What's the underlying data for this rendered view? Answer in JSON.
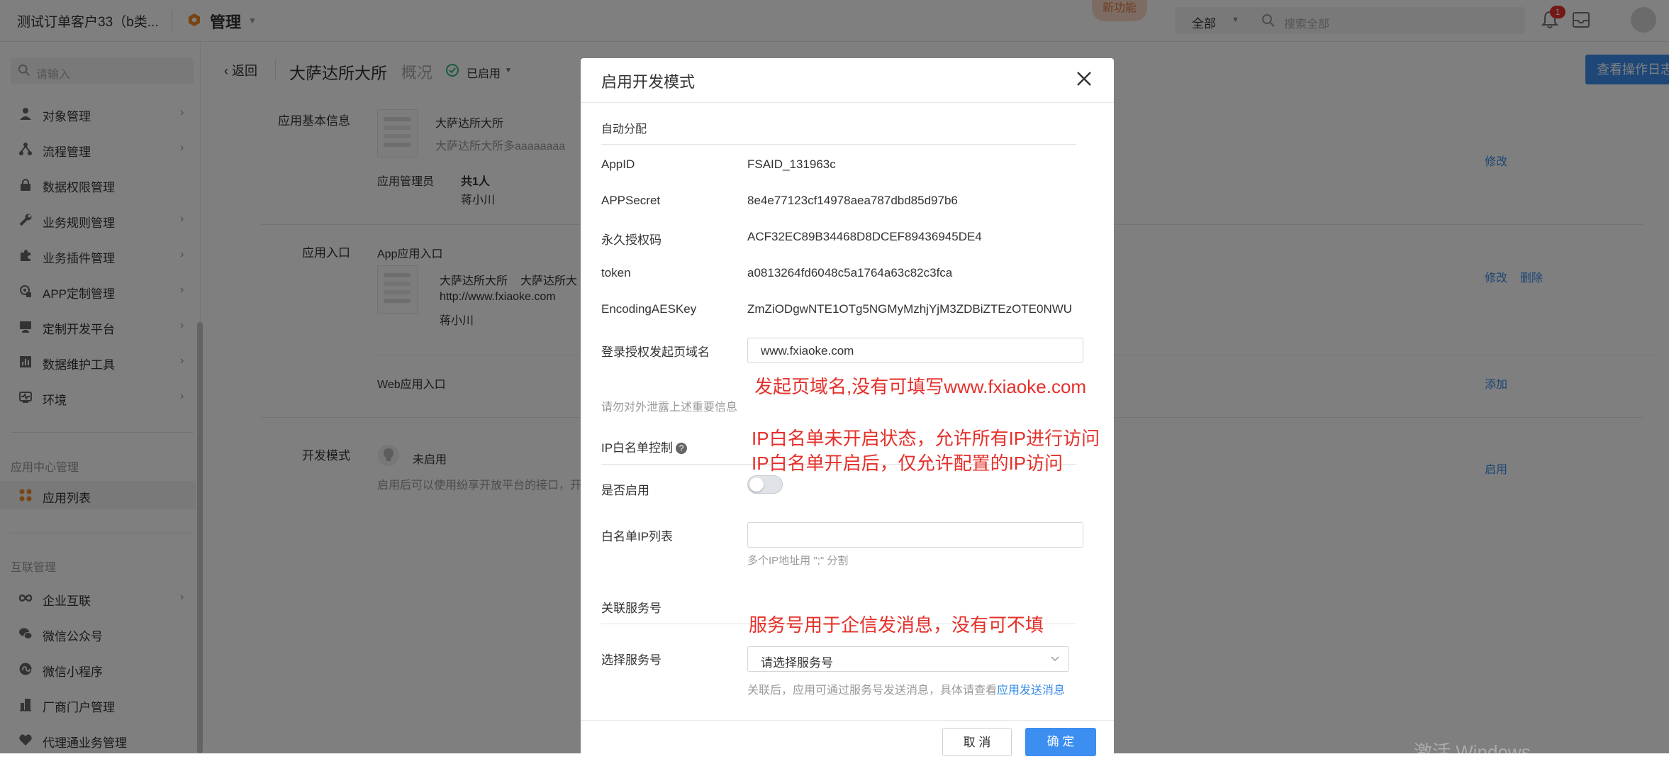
{
  "topbar": {
    "company": "测试订单客户33（b类...",
    "manage_label": "管理",
    "new_feature": "新功能",
    "search_scope": "全部",
    "search_placeholder": "搜索全部",
    "notification_count": "1"
  },
  "sidebar": {
    "search_placeholder": "请输入",
    "items": [
      {
        "label": "对象管理",
        "icon": "cube-icon",
        "has_arrow": true
      },
      {
        "label": "流程管理",
        "icon": "flow-icon",
        "has_arrow": true
      },
      {
        "label": "数据权限管理",
        "icon": "lock-icon",
        "has_arrow": false
      },
      {
        "label": "业务规则管理",
        "icon": "wrench-icon",
        "has_arrow": true
      },
      {
        "label": "业务插件管理",
        "icon": "puzzle-icon",
        "has_arrow": true
      },
      {
        "label": "APP定制管理",
        "icon": "app-icon",
        "has_arrow": true
      },
      {
        "label": "定制开发平台",
        "icon": "monitor-icon",
        "has_arrow": true
      },
      {
        "label": "数据维护工具",
        "icon": "chart-icon",
        "has_arrow": true
      },
      {
        "label": "环境",
        "icon": "heartbeat-icon",
        "has_arrow": true
      }
    ],
    "group_app_center": "应用中心管理",
    "app_list": "应用列表",
    "group_interconnect": "互联管理",
    "items2": [
      {
        "label": "企业互联",
        "icon": "link-icon",
        "has_arrow": true
      },
      {
        "label": "微信公众号",
        "icon": "wechat-icon",
        "has_arrow": false
      },
      {
        "label": "微信小程序",
        "icon": "miniprogram-icon",
        "has_arrow": false
      },
      {
        "label": "厂商门户管理",
        "icon": "building-icon",
        "has_arrow": false
      },
      {
        "label": "代理通业务管理",
        "icon": "handshake-icon",
        "has_arrow": false
      }
    ]
  },
  "header": {
    "back": "返回",
    "app_name": "大萨达所大所",
    "tab_overview": "概况",
    "status": "已启用",
    "op_log": "查看操作日志"
  },
  "content": {
    "basic_info_label": "应用基本信息",
    "app_name": "大萨达所大所",
    "app_desc": "大萨达所大所多aaaaaaaa",
    "admin_label": "应用管理员",
    "admin_count": "共1人",
    "admin_name": "蒋小川",
    "edit": "修改",
    "entry_label": "应用入口",
    "app_entry": "App应用入口",
    "entry_name": "大萨达所大所",
    "entry_name2": "大萨达所大",
    "entry_url": "http://www.fxiaoke.com",
    "entry_owner": "蒋小川",
    "edit2": "修改",
    "delete": "删除",
    "web_entry": "Web应用入口",
    "add": "添加",
    "dev_label": "开发模式",
    "dev_status": "未启用",
    "dev_desc": "启用后可以使用纷享开放平台的接口，开",
    "enable": "启用"
  },
  "modal": {
    "title": "启用开发模式",
    "section_auto": "自动分配",
    "fields": [
      {
        "label": "AppID",
        "value": "FSAID_131963c"
      },
      {
        "label": "APPSecret",
        "value": "8e4e77123cf14978aea787dbd85d97b6"
      },
      {
        "label": "永久授权码",
        "value": "ACF32EC89B34468D8DCEF89436945DE4"
      },
      {
        "label": "token",
        "value": "a0813264fd6048c5a1764a63c82c3fca"
      },
      {
        "label": "EncodingAESKey",
        "value": "ZmZiODgwNTE1OTg5NGMyMzhjYjM3ZDBiZTEzOTE0NWU"
      }
    ],
    "domain_label": "登录授权发起页域名",
    "domain_value": "www.fxiaoke.com",
    "secret_hint": "请勿对外泄露上述重要信息",
    "ip_section": "IP白名单控制",
    "enable_label": "是否启用",
    "ip_list_label": "白名单IP列表",
    "ip_list_hint": "多个IP地址用 \";\" 分割",
    "service_section": "关联服务号",
    "service_label": "选择服务号",
    "service_placeholder": "请选择服务号",
    "service_hint": "关联后，应用可通过服务号发送消息，具体请查看",
    "service_link": "应用发送消息",
    "cancel": "取 消",
    "ok": "确 定"
  },
  "annotations": {
    "domain_note": "发起页域名,没有可填写www.fxiaoke.com",
    "ip_note_1": "IP白名单未开启状态，允许所有IP进行访问",
    "ip_note_2": "IP白名单开启后，仅允许配置的IP访问",
    "service_note": "服务号用于企信发消息，没有可不填"
  },
  "watermark": "激活 Windows",
  "colors": {
    "primary": "#3c8ef0",
    "annotation": "#e5302a",
    "badge": "#e5312c",
    "manage_icon": "#f08a24"
  }
}
